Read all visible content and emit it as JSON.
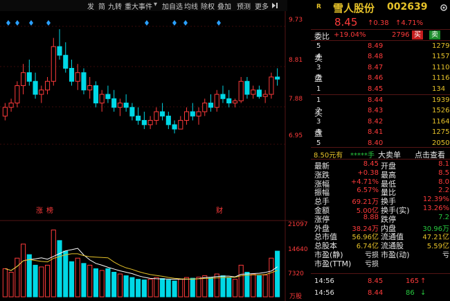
{
  "toolbar": {
    "items": [
      "发",
      "简",
      "九转",
      "重大事件",
      "加自选",
      "均线",
      "除权",
      "叠加",
      "预测",
      "更多"
    ],
    "dropdown_marker": "▾"
  },
  "stock": {
    "name": "雪人股份",
    "code": "002639",
    "price": "8.45",
    "change": "↑0.38",
    "change_pct": "↑4.71%",
    "wei_bi_label": "委比",
    "wei_bi": "+19.04%",
    "wei_cha": "2796",
    "buy_btn": "买",
    "sell_btn": "卖"
  },
  "order_book": {
    "sell_label_chars": [
      "卖",
      "盘"
    ],
    "buy_label_chars": [
      "买",
      "盘"
    ],
    "sell": [
      {
        "lvl": "5",
        "price": "8.49",
        "vol": "1279"
      },
      {
        "lvl": "4",
        "price": "8.48",
        "vol": "1157"
      },
      {
        "lvl": "3",
        "price": "8.47",
        "vol": "1110"
      },
      {
        "lvl": "2",
        "price": "8.46",
        "vol": "1116"
      },
      {
        "lvl": "1",
        "price": "8.45",
        "vol": "134"
      }
    ],
    "buy": [
      {
        "lvl": "1",
        "price": "8.44",
        "vol": "1939"
      },
      {
        "lvl": "2",
        "price": "8.43",
        "vol": "1526"
      },
      {
        "lvl": "3",
        "price": "8.42",
        "vol": "1164"
      },
      {
        "lvl": "4",
        "price": "8.41",
        "vol": "1275"
      },
      {
        "lvl": "5",
        "price": "8.40",
        "vol": "2050"
      }
    ]
  },
  "bar2": {
    "price_text": "8.50元有",
    "stars": "*****手",
    "big_order": "大卖单",
    "click": "点击查看"
  },
  "stats": [
    {
      "l1": "最新",
      "v1": "8.45",
      "c1": "red",
      "l2": "开盘",
      "v2": "8.1",
      "c2": "red"
    },
    {
      "l1": "涨跌",
      "v1": "+0.38",
      "c1": "red",
      "l2": "最高",
      "v2": "8.5",
      "c2": "red"
    },
    {
      "l1": "涨幅",
      "v1": "+4.71%",
      "c1": "red",
      "l2": "最低",
      "v2": "8.0",
      "c2": "red"
    },
    {
      "l1": "振幅",
      "v1": "6.57%",
      "c1": "red",
      "l2": "量比",
      "v2": "2.2",
      "c2": "red"
    },
    {
      "l1": "总手",
      "v1": "69.21万",
      "c1": "red",
      "l2": "换手",
      "v2": "12.39%",
      "c2": "red"
    },
    {
      "l1": "金额",
      "v1": "5.00亿",
      "c1": "red",
      "l2": "换手(实)",
      "v2": "13.26%",
      "c2": "red"
    },
    {
      "l1": "涨停",
      "v1": "8.88",
      "c1": "red",
      "l2": "跌停",
      "v2": "7.2",
      "c2": "green"
    },
    {
      "l1": "外盘",
      "v1": "38.24万",
      "c1": "red",
      "l2": "内盘",
      "v2": "30.96万",
      "c2": "green"
    },
    {
      "l1": "总市值",
      "v1": "56.96亿",
      "c1": "yellow",
      "l2": "流通值",
      "v2": "47.21亿",
      "c2": "yellow"
    },
    {
      "l1": "总股本",
      "v1": "6.74亿",
      "c1": "yellow",
      "l2": "流通股",
      "v2": "5.59亿",
      "c2": "yellow"
    },
    {
      "l1": "市盈(静)",
      "v1": "亏损",
      "c1": "white",
      "l2": "市盈(动)",
      "v2": "亏",
      "c2": "white"
    },
    {
      "l1": "市盈(TTM)",
      "v1": "亏损",
      "c1": "white",
      "l2": "",
      "v2": "",
      "c2": "white"
    }
  ],
  "ticks": [
    {
      "time": "14:56",
      "price": "8.45",
      "vol": "165",
      "dir": "↑"
    },
    {
      "time": "14:56",
      "price": "8.44",
      "vol": "86",
      "dir": "↓"
    }
  ],
  "chart_labels": {
    "price_axis": [
      "9.73",
      "8.81",
      "7.88",
      "6.95"
    ],
    "vol_axis": [
      "21097",
      "14640",
      "7320",
      "万股"
    ],
    "annotations": [
      "涨",
      "榜",
      "财"
    ]
  },
  "chart_data": {
    "type": "bar",
    "title": "",
    "price_range": [
      6.95,
      9.73
    ],
    "volume_range": [
      0,
      21097
    ],
    "candles": [
      [
        7.6,
        7.9,
        7.5,
        7.8
      ],
      [
        7.8,
        8.0,
        7.7,
        7.9
      ],
      [
        7.9,
        8.4,
        7.8,
        8.3
      ],
      [
        8.3,
        8.8,
        8.1,
        8.6
      ],
      [
        8.6,
        8.9,
        8.3,
        8.4
      ],
      [
        8.4,
        8.6,
        8.0,
        8.1
      ],
      [
        8.1,
        8.3,
        7.9,
        8.2
      ],
      [
        8.2,
        8.5,
        8.1,
        8.4
      ],
      [
        8.4,
        9.4,
        8.3,
        9.2
      ],
      [
        9.2,
        9.6,
        8.9,
        9.0
      ],
      [
        9.0,
        9.3,
        8.6,
        8.7
      ],
      [
        8.7,
        8.9,
        8.3,
        8.4
      ],
      [
        8.4,
        8.8,
        8.2,
        8.6
      ],
      [
        8.6,
        8.7,
        8.1,
        8.2
      ],
      [
        8.2,
        8.5,
        8.0,
        8.3
      ],
      [
        8.3,
        8.4,
        7.8,
        7.9
      ],
      [
        7.9,
        8.2,
        7.7,
        8.1
      ],
      [
        8.1,
        8.3,
        7.9,
        8.0
      ],
      [
        8.0,
        8.2,
        7.7,
        7.8
      ],
      [
        7.8,
        8.0,
        7.6,
        7.9
      ],
      [
        7.9,
        8.1,
        7.7,
        7.8
      ],
      [
        7.8,
        7.9,
        7.5,
        7.6
      ],
      [
        7.6,
        7.8,
        7.4,
        7.5
      ],
      [
        7.5,
        7.7,
        7.3,
        7.4
      ],
      [
        7.4,
        7.6,
        7.3,
        7.5
      ],
      [
        7.5,
        7.8,
        7.4,
        7.7
      ],
      [
        7.7,
        7.9,
        7.5,
        7.6
      ],
      [
        7.6,
        7.7,
        7.3,
        7.4
      ],
      [
        7.4,
        7.5,
        7.2,
        7.3
      ],
      [
        7.3,
        7.6,
        7.3,
        7.5
      ],
      [
        7.5,
        7.8,
        7.4,
        7.7
      ],
      [
        7.7,
        7.9,
        7.5,
        7.6
      ],
      [
        7.6,
        7.8,
        7.4,
        7.7
      ],
      [
        7.7,
        8.0,
        7.6,
        7.9
      ],
      [
        7.9,
        8.1,
        7.7,
        7.8
      ],
      [
        7.8,
        8.2,
        7.7,
        8.1
      ],
      [
        8.1,
        8.3,
        7.9,
        8.0
      ],
      [
        8.0,
        8.2,
        7.8,
        7.9
      ],
      [
        7.9,
        8.0,
        7.8,
        7.95
      ],
      [
        7.95,
        8.5,
        7.9,
        8.4
      ],
      [
        8.4,
        8.5,
        8.0,
        8.1
      ],
      [
        8.1,
        8.3,
        8.0,
        8.2
      ],
      [
        8.2,
        8.3,
        8.0,
        8.05
      ],
      [
        8.05,
        8.2,
        7.9,
        8.1
      ],
      [
        8.1,
        8.6,
        8.0,
        8.5
      ],
      [
        8.5,
        8.7,
        8.3,
        8.45
      ]
    ],
    "volumes": [
      8000,
      7000,
      11000,
      15000,
      12000,
      9000,
      8500,
      9000,
      19000,
      16000,
      13000,
      10000,
      11000,
      9500,
      9000,
      8000,
      7500,
      8000,
      7000,
      6500,
      6000,
      5500,
      5000,
      4800,
      5000,
      5500,
      5200,
      4800,
      4500,
      5000,
      5500,
      5300,
      5600,
      6000,
      5400,
      6500,
      6000,
      5500,
      5000,
      9000,
      7000,
      6500,
      6000,
      6200,
      11000,
      13000
    ]
  }
}
